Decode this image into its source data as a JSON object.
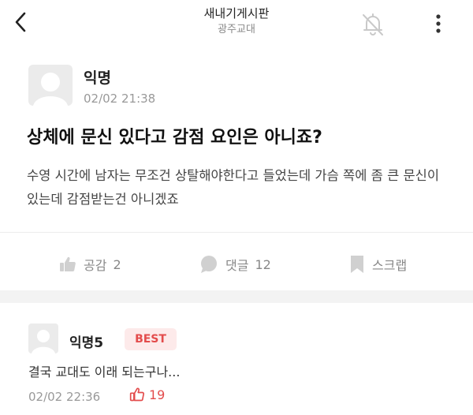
{
  "header": {
    "title": "새내기게시판",
    "subtitle": "광주교대",
    "back_icon": "chevron-left-icon",
    "notification_icon": "bell-off-icon",
    "more_icon": "more-vertical-icon"
  },
  "post": {
    "author": "익명",
    "date": "02/02 21:38",
    "title": "상체에 문신 있다고 감점 요인은 아니죠?",
    "body": "수영 시간에 남자는 무조건 상탈해야한다고 들었는데 가슴 쪽에 좀 큰 문신이 있는데 감점받는건 아니겠죠",
    "actions": {
      "like": {
        "label": "공감",
        "count": "2",
        "icon": "thumbs-up-icon"
      },
      "comment": {
        "label": "댓글",
        "count": "12",
        "icon": "comment-bubble-icon"
      },
      "scrap": {
        "label": "스크랩",
        "icon": "bookmark-icon"
      }
    }
  },
  "comments": [
    {
      "author": "익명5",
      "badge": "BEST",
      "text": "결국 교대도 이래 되는구나...",
      "date": "02/02 22:36",
      "likes": "19",
      "like_icon": "thumbs-up-outline-icon"
    }
  ],
  "colors": {
    "accent_red": "#e34c4c",
    "best_badge_bg": "#fdeaea",
    "muted": "#888888",
    "avatar_bg": "#ebebeb"
  }
}
